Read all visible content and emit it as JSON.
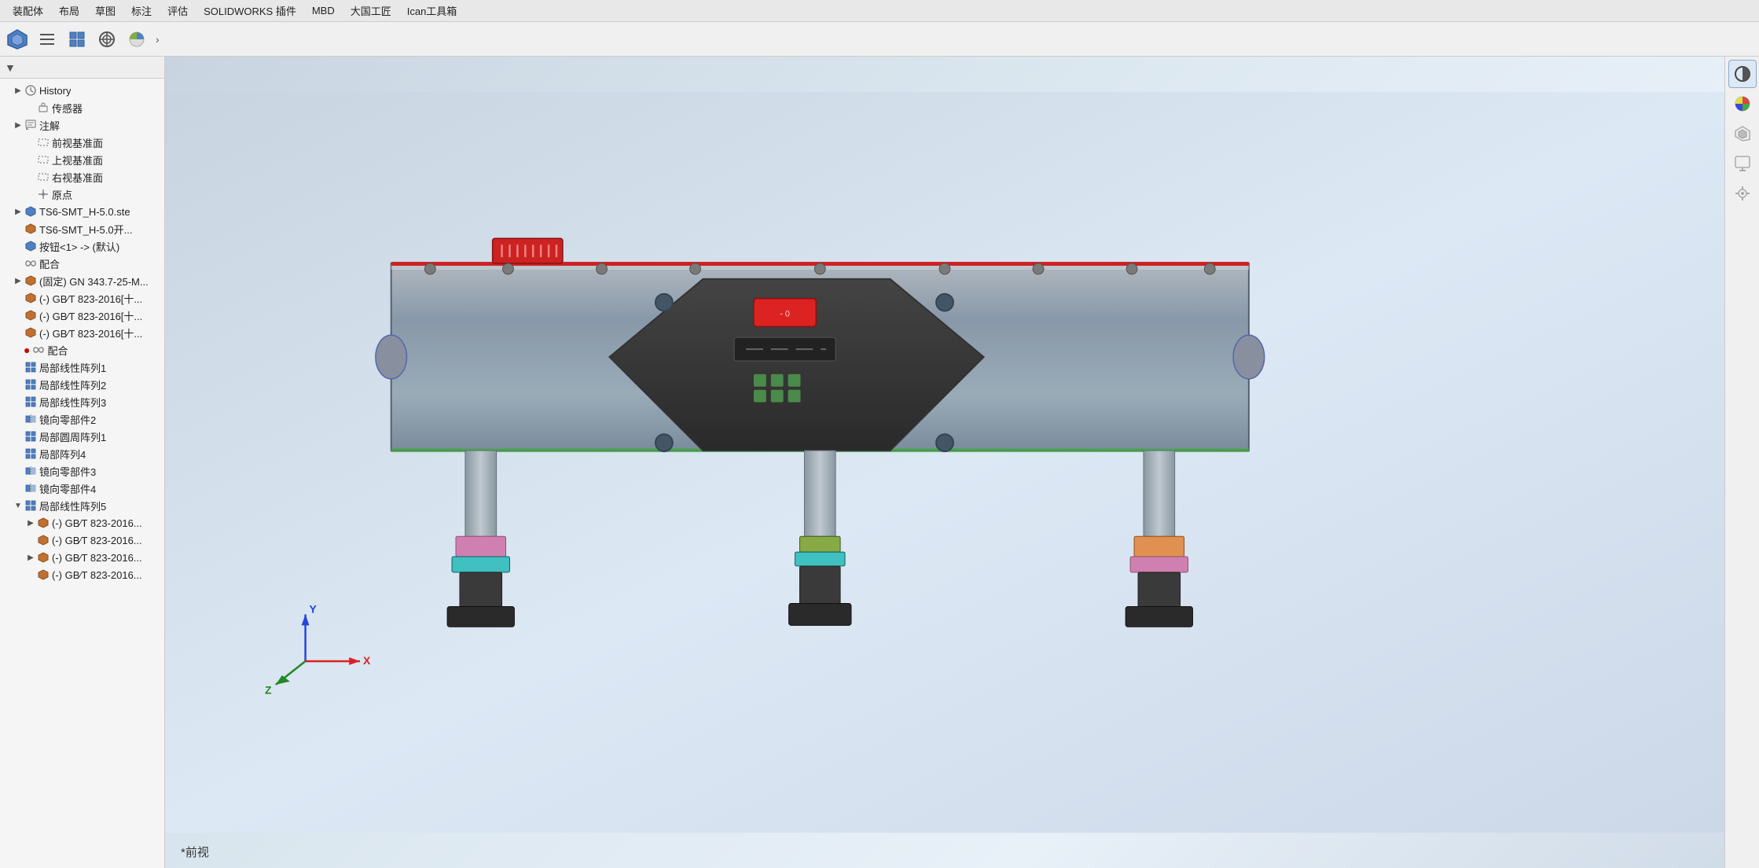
{
  "menu": {
    "items": [
      "装配体",
      "布局",
      "草图",
      "标注",
      "评估",
      "SOLIDWORKS 插件",
      "MBD",
      "大国工匠",
      "Ican工具箱"
    ]
  },
  "toolbar": {
    "buttons": [
      {
        "name": "assembly-icon",
        "icon": "⬡",
        "label": "装配体"
      },
      {
        "name": "list-icon",
        "icon": "≡",
        "label": "列表"
      },
      {
        "name": "component-icon",
        "icon": "⊞",
        "label": "零部件"
      },
      {
        "name": "target-icon",
        "icon": "⊕",
        "label": "目标"
      },
      {
        "name": "chart-icon",
        "icon": "◔",
        "label": "图表"
      }
    ],
    "arrow": "›"
  },
  "filter": {
    "icon": "▼",
    "label": "筛选"
  },
  "tree": {
    "items": [
      {
        "id": "history",
        "label": "History",
        "indent": 1,
        "expandable": true,
        "icon": "🕐",
        "iconClass": "icon-history"
      },
      {
        "id": "sensor",
        "label": "传感器",
        "indent": 2,
        "expandable": false,
        "icon": "📡",
        "iconClass": "icon-sensor"
      },
      {
        "id": "annotation",
        "label": "注解",
        "indent": 1,
        "expandable": true,
        "icon": "📝",
        "iconClass": "icon-annotation"
      },
      {
        "id": "front-plane",
        "label": "前视基准面",
        "indent": 2,
        "expandable": false,
        "icon": "▭",
        "iconClass": "icon-plane"
      },
      {
        "id": "top-plane",
        "label": "上视基准面",
        "indent": 2,
        "expandable": false,
        "icon": "▭",
        "iconClass": "icon-plane"
      },
      {
        "id": "right-plane",
        "label": "右视基准面",
        "indent": 2,
        "expandable": false,
        "icon": "▭",
        "iconClass": "icon-plane"
      },
      {
        "id": "origin",
        "label": "原点",
        "indent": 2,
        "expandable": false,
        "icon": "✛",
        "iconClass": "icon-origin"
      },
      {
        "id": "ts6-smt-ste",
        "label": "TS6-SMT_H-5.0.ste",
        "indent": 1,
        "expandable": true,
        "icon": "⬡",
        "iconClass": "icon-part-blue"
      },
      {
        "id": "ts6-smt-kai",
        "label": "TS6-SMT_H-5.0开...",
        "indent": 1,
        "expandable": false,
        "icon": "⬡",
        "iconClass": "icon-part-orange"
      },
      {
        "id": "button-default",
        "label": "按钮<1> -> (默认)",
        "indent": 1,
        "expandable": false,
        "icon": "⬡",
        "iconClass": "icon-part-blue"
      },
      {
        "id": "assembly1",
        "label": "配合",
        "indent": 1,
        "expandable": false,
        "icon": "∞",
        "iconClass": "icon-assembly"
      },
      {
        "id": "fixed-gn",
        "label": "(固定) GN 343.7-25-M...",
        "indent": 1,
        "expandable": true,
        "icon": "⬡",
        "iconClass": "icon-part-orange"
      },
      {
        "id": "gb-1",
        "label": "(-) GB∕T 823-2016[十...",
        "indent": 1,
        "expandable": false,
        "icon": "⬡",
        "iconClass": "icon-part-orange"
      },
      {
        "id": "gb-2",
        "label": "(-) GB∕T 823-2016[十...",
        "indent": 1,
        "expandable": false,
        "icon": "⬡",
        "iconClass": "icon-part-orange"
      },
      {
        "id": "gb-3",
        "label": "(-) GB∕T 823-2016[十...",
        "indent": 1,
        "expandable": false,
        "icon": "⬡",
        "iconClass": "icon-part-orange"
      },
      {
        "id": "assembly2",
        "label": "配合",
        "indent": 1,
        "expandable": false,
        "icon": "∞",
        "iconClass": "icon-assembly",
        "hasError": true
      },
      {
        "id": "array1",
        "label": "局部线性阵列1",
        "indent": 1,
        "expandable": false,
        "icon": "⠿",
        "iconClass": "icon-array"
      },
      {
        "id": "array2",
        "label": "局部线性阵列2",
        "indent": 1,
        "expandable": false,
        "icon": "⠿",
        "iconClass": "icon-array"
      },
      {
        "id": "array3",
        "label": "局部线性阵列3",
        "indent": 1,
        "expandable": false,
        "icon": "⠿",
        "iconClass": "icon-array"
      },
      {
        "id": "mirror2",
        "label": "镜向零部件2",
        "indent": 1,
        "expandable": false,
        "icon": "⊞",
        "iconClass": "icon-mirror"
      },
      {
        "id": "circle-array1",
        "label": "局部圆周阵列1",
        "indent": 1,
        "expandable": false,
        "icon": "⠿",
        "iconClass": "icon-array"
      },
      {
        "id": "array4",
        "label": "局部阵列4",
        "indent": 1,
        "expandable": false,
        "icon": "⠿",
        "iconClass": "icon-array"
      },
      {
        "id": "mirror3",
        "label": "镜向零部件3",
        "indent": 1,
        "expandable": false,
        "icon": "⊞",
        "iconClass": "icon-mirror"
      },
      {
        "id": "mirror4",
        "label": "镜向零部件4",
        "indent": 1,
        "expandable": false,
        "icon": "⊞",
        "iconClass": "icon-mirror"
      },
      {
        "id": "array5",
        "label": "局部线性阵列5",
        "indent": 1,
        "expandable": true,
        "icon": "⠿",
        "iconClass": "icon-array",
        "expanded": true
      },
      {
        "id": "gb-4",
        "label": "(-) GB∕T 823-2016...",
        "indent": 2,
        "expandable": true,
        "icon": "⬡",
        "iconClass": "icon-part-orange"
      },
      {
        "id": "gb-5",
        "label": "(-) GB∕T 823-2016...",
        "indent": 2,
        "expandable": false,
        "icon": "⬡",
        "iconClass": "icon-part-orange"
      },
      {
        "id": "gb-6",
        "label": "(-) GB∕T 823-2016...",
        "indent": 2,
        "expandable": true,
        "icon": "⬡",
        "iconClass": "icon-part-orange"
      },
      {
        "id": "gb-7",
        "label": "(-) GB∕T 823-2016...",
        "indent": 2,
        "expandable": false,
        "icon": "⬡",
        "iconClass": "icon-part-orange"
      }
    ]
  },
  "viewport": {
    "view_label": "*前视",
    "bg_color_start": "#c8d4e0",
    "bg_color_end": "#e8f0f8"
  },
  "right_toolbar": {
    "buttons": [
      {
        "name": "appearance-icon",
        "icon": "◐",
        "label": "外观",
        "active": true
      },
      {
        "name": "color-wheel-icon",
        "icon": "◕",
        "label": "颜色"
      },
      {
        "name": "texture-icon",
        "icon": "⬡",
        "label": "纹理"
      },
      {
        "name": "display-icon",
        "icon": "▣",
        "label": "显示"
      },
      {
        "name": "settings2-icon",
        "icon": "⊕",
        "label": "设置"
      }
    ]
  },
  "coord_axes": {
    "x_color": "#dd2222",
    "y_color": "#2222dd",
    "z_color": "#22aa22",
    "x_label": "X",
    "y_label": "Y",
    "z_label": "Z"
  }
}
